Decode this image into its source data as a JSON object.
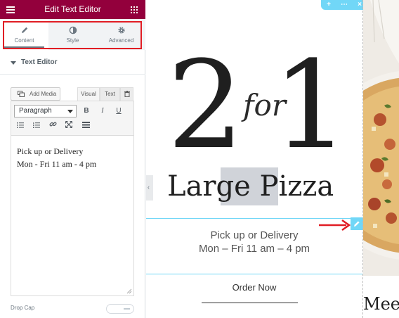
{
  "panel": {
    "title": "Edit Text Editor",
    "tabs": [
      {
        "label": "Content",
        "icon": "pencil-icon",
        "active": true
      },
      {
        "label": "Style",
        "icon": "contrast-icon",
        "active": false
      },
      {
        "label": "Advanced",
        "icon": "gear-icon",
        "active": false
      }
    ],
    "section_title": "Text Editor",
    "add_media_label": "Add Media",
    "mode_tabs": {
      "visual": "Visual",
      "text": "Text"
    },
    "format_value": "Paragraph",
    "toolbar_buttons": {
      "bold": "B",
      "italic": "I",
      "underline": "U"
    },
    "content_lines": [
      "Pick up or Delivery",
      "Mon - Fri 11 am - 4 pm"
    ],
    "drop_cap_label": "Drop Cap"
  },
  "canvas": {
    "heading_two": "2",
    "heading_for": "for",
    "heading_one": "1",
    "sub_heading": "Large Pizza",
    "text_lines": [
      "Pick up or Delivery",
      "Mon – Fri 11 am – 4 pm"
    ],
    "order_now": "Order Now",
    "meet_text": "Meet"
  },
  "colors": {
    "panel_header": "#93003c",
    "highlight_red": "#e11d24",
    "editor_accent": "#71d7f7"
  }
}
